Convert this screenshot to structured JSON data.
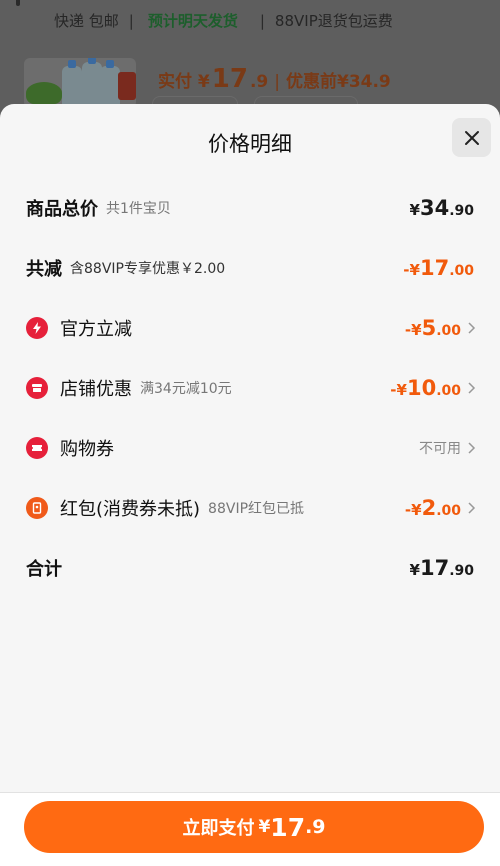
{
  "background": {
    "shipping_items": [
      "快递 包邮"
    ],
    "shipping_highlight": "预计明天发货",
    "shipping_vip": "88VIP退货包运费",
    "paid_label": "实付",
    "paid_symbol": "¥",
    "paid_int": "17",
    "paid_dec": ".9",
    "before_discount": "优惠前¥34.9"
  },
  "sheet": {
    "title": "价格明细",
    "close_icon": "close-icon"
  },
  "rows": {
    "total": {
      "label": "商品总价",
      "note": "共1件宝贝",
      "yen": "¥",
      "int": "34",
      "dec": ".90"
    },
    "discount": {
      "label": "共减",
      "note": "含88VIP专享优惠￥2.00",
      "yen": "-¥",
      "int": "17",
      "dec": ".00"
    },
    "official": {
      "label": "官方立减",
      "yen": "-¥",
      "int": "5",
      "dec": ".00",
      "icon": "lightning-icon"
    },
    "store": {
      "label": "店铺优惠",
      "note": "满34元减10元",
      "yen": "-¥",
      "int": "10",
      "dec": ".00",
      "icon": "store-icon"
    },
    "coupon": {
      "label": "购物券",
      "value": "不可用",
      "icon": "ticket-icon"
    },
    "redpacket": {
      "label": "红包(消费券未抵)",
      "note": "88VIP红包已抵",
      "yen": "-¥",
      "int": "2",
      "dec": ".00",
      "icon": "redpacket-icon"
    },
    "sum": {
      "label": "合计",
      "yen": "¥",
      "int": "17",
      "dec": ".90"
    }
  },
  "footer": {
    "pay_label": "立即支付",
    "yen": "¥",
    "int": "17",
    "dec": ".9"
  },
  "colors": {
    "accent": "#ff6a12",
    "discount": "#f15a0c",
    "icon_red": "#e6203a",
    "sheet_bg": "#f6f6f6"
  }
}
